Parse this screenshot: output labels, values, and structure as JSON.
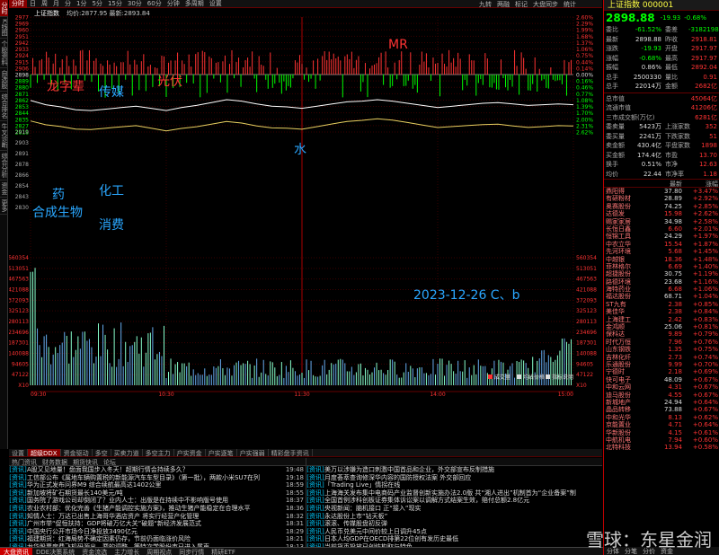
{
  "left_tabs": [
    "分时",
    "K线图",
    "个股资料",
    "自选股",
    "综合排名",
    "牛叉诊断",
    "综合分析",
    "资金",
    "更多"
  ],
  "toolbar": {
    "items": [
      "分时",
      "日",
      "周",
      "月",
      "分",
      "1分",
      "5分",
      "15分",
      "30分",
      "60分",
      "分钟",
      "多周期",
      "设置"
    ],
    "right": [
      "九转",
      "两融",
      "标记",
      "大盘同步",
      "统计"
    ]
  },
  "chart_info": {
    "name": "上证指数",
    "meta": "均价:2877.95 最新:2893.84"
  },
  "price_axis": {
    "left": [
      "2977",
      "2969",
      "2960",
      "2951",
      "2942",
      "2933",
      "2924",
      "2915",
      "2906",
      "2898",
      "2889",
      "2880",
      "2871",
      "2862",
      "2853",
      "2844",
      "2835",
      "2827",
      "2818"
    ],
    "right": [
      "2.60%",
      "2.29%",
      "1.99%",
      "1.68%",
      "1.37%",
      "1.06%",
      "0.75%",
      "0.44%",
      "0.14%",
      "0.00%",
      "0.16%",
      "0.46%",
      "0.77%",
      "1.08%",
      "1.39%",
      "1.70%",
      "2.00%",
      "2.31%",
      "2.62%"
    ]
  },
  "indicator_axis": [
    "2919",
    "2903",
    "2891",
    "2878",
    "2866",
    "2854",
    "2843",
    "2830"
  ],
  "volume_axis": [
    "560354",
    "513051",
    "467563",
    "421088",
    "372093",
    "325123",
    "280113",
    "234696",
    "187301",
    "140088",
    "94605",
    "47122",
    "X10"
  ],
  "time_labels": [
    "09:30",
    "10:30",
    "11:30",
    "14:00",
    "15:00"
  ],
  "volume_legend": [
    "成交量",
    "均线价格",
    "指标说明"
  ],
  "chart_data": {
    "type": "line",
    "title": "",
    "series": [
      {
        "values": [
          2898.88,
          2893,
          2890,
          2886,
          2885,
          2887,
          2889,
          2891,
          2888,
          2885,
          2889,
          2892,
          2896,
          2900,
          2898,
          2894,
          2891,
          2890,
          2888,
          2891,
          2894,
          2897,
          2898,
          2900,
          2898,
          2895,
          2892,
          2889,
          2891,
          2893,
          2895,
          2896,
          2894,
          2892,
          2893,
          2894,
          2893
        ]
      }
    ]
  },
  "annotations": {
    "a1": "龙字辈",
    "a2": "传媒",
    "a3": "光伏",
    "a4": "MR",
    "a5": "水",
    "a6": "药",
    "a7": "化工",
    "a8": "合成生物",
    "a9": "消费",
    "a10": "2023-12-26 C、b"
  },
  "bottom_tabs": [
    "设置",
    "超级DDX",
    "资金驱动",
    "多空",
    "买卖力道",
    "多空主力",
    "户实资金",
    "户实逐笔",
    "户实强弱",
    "精彩盘手资讯"
  ],
  "news_left_head": [
    "热门资讯",
    "财务数据",
    "期货快讯",
    "论坛"
  ],
  "news_right_head": [
    "",
    ""
  ],
  "news_left": [
    {
      "b": "资讯",
      "t": "A股又见地量！盘面我国步入冬天！超期行情会持续多久？",
      "tm": "19:48"
    },
    {
      "b": "资讯",
      "t": "工信部公布《属地车辆购置税的新能源汽车车型目录》（第一批），两款小米SU7在列",
      "tm": "19:18"
    },
    {
      "b": "资讯",
      "t": "华为正式发布问界M9 综合续航最高达1402公里",
      "tm": "18:59"
    },
    {
      "b": "资讯",
      "t": "新加坡将矿石期货最长140美元/吨",
      "tm": "18:55"
    },
    {
      "b": "资讯",
      "t": "国务院了游戏公司却倒闭了？业内人士：出版是在持续中不影响版号使用",
      "tm": "18:37"
    },
    {
      "b": "资讯",
      "t": "农业农村部：优化完善《生猪产能调控实施方案》，推动生猪产能稳定在合理水平",
      "tm": "18:36"
    },
    {
      "b": "资讯",
      "t": "知情人士：万达已出售上海哥华酒店资产 将实行经营产化管理",
      "tm": "18:32"
    },
    {
      "b": "资讯",
      "t": "广州市举“促恒扶持：GDP将破万亿大关”破题“新经济发展范式",
      "tm": "18:31"
    },
    {
      "b": "资讯",
      "t": "中国央行公开市场今日净投放3490亿元",
      "tm": "18:29"
    },
    {
      "b": "资讯",
      "t": "福建期货：红海局势不确定因素仍存，节前仍面临涨价风险",
      "tm": "18:21"
    },
    {
      "b": "资讯",
      "t": "龙华股票度费飞机码源出，要的调整，等特次学股份市已进入尾声",
      "tm": "18:13"
    },
    {
      "b": "资讯",
      "t": "产业链人士：预计华为nova 12系列出货量千万级",
      "tm": "18:13"
    }
  ],
  "news_right": [
    {
      "b": "资讯",
      "t": "美万以涉嫌为造口刺激中国首品和企业，外交部宣布反制措施",
      "tm": ""
    },
    {
      "b": "资讯",
      "t": "月度荟萃查询修深华内容的国防授权法案 外交部回应",
      "tm": ""
    },
    {
      "b": "资讯",
      "t": "「Trading Live」情拐在线",
      "tm": ""
    },
    {
      "b": "资讯",
      "t": "上海海关发布集中电商码产业监督创新实施办法2.0版 共“湘人进出”机制首为“企业备案”制",
      "tm": ""
    },
    {
      "b": "资讯",
      "t": "全国首例涉科创板证券集体诉讼案以调解方式结案生效，赔付总额2.8亿元",
      "tm": ""
    },
    {
      "b": "资讯",
      "t": "央视新闻：脑机接口 正“接入”现实",
      "tm": ""
    },
    {
      "b": "资讯",
      "t": "永达股份上市“钻天板”",
      "tm": ""
    },
    {
      "b": "资讯",
      "t": "滚滚、传媒股盘初反弹",
      "tm": ""
    },
    {
      "b": "资讯",
      "t": "人民币兑美元中间价较上日调升45点",
      "tm": ""
    },
    {
      "b": "资讯",
      "t": "日本人均GDP在OECD排第22位创有发历史最低",
      "tm": ""
    },
    {
      "b": "资讯",
      "t": "当前货币投放已创结构取与特色",
      "tm": ""
    },
    {
      "b": "资讯",
      "t": "知情人士：泸州老窖降价引发经销商不满，为平息怒火宣布价格回调",
      "tm": ""
    }
  ],
  "status": [
    "大盘资讯",
    "DDE决策系统",
    "资金流选",
    "主力增长",
    "周期视点",
    "同步行情",
    "精研ETF"
  ],
  "quote": {
    "header": "上证指数 000001",
    "price": "2898.88",
    "change": "-19.93",
    "pct": "-0.68%",
    "rows": [
      [
        "委比",
        "-61.52%",
        "委差",
        "-31821987"
      ],
      [
        "最新",
        "2898.88",
        "昨收",
        "2918.81"
      ],
      [
        "涨跌",
        "-19.93",
        "开盘",
        "2917.97"
      ],
      [
        "涨幅",
        "-0.68%",
        "最高",
        "2917.97"
      ],
      [
        "振幅",
        "0.86%",
        "最低",
        "2892.04"
      ],
      [
        "总手",
        "2500330",
        "量比",
        "0.91"
      ],
      [
        "总手",
        "22014万",
        "金额",
        "2682亿"
      ]
    ],
    "rows2": [
      [
        "总市值",
        "",
        "",
        "45064亿"
      ],
      [
        "流通市值",
        "",
        "",
        "41206亿"
      ],
      [
        "三市成交额(万亿)",
        "",
        "",
        "6281亿"
      ],
      [
        "委卖量",
        "5423万",
        "上涨家数",
        "352"
      ],
      [
        "委买量",
        "2241万",
        "下跌家数",
        "51"
      ],
      [
        "卖金额",
        "430.4亿",
        "平盘家数",
        "1898"
      ],
      [
        "买金额",
        "174.4亿",
        "市盈",
        "13.70"
      ],
      [
        "换手",
        "0.51%",
        "市净",
        "12.63"
      ],
      [
        "均价",
        "22.44",
        "市净率",
        "1.18"
      ]
    ],
    "stock_head": [
      "",
      "最新",
      "涨幅"
    ],
    "stocks": [
      [
        "鼎阳得",
        "37.80",
        "+3.47%"
      ],
      [
        "有研粉材",
        "28.89",
        "+2.92%"
      ],
      [
        "奥赛股份",
        "74.25",
        "+2.85%"
      ],
      [
        "达德发",
        "15.98",
        "+2.62%"
      ],
      [
        "赐家家居",
        "34.98",
        "+2.58%"
      ],
      [
        "长恒日鑫",
        "6.60",
        "+2.01%"
      ],
      [
        "恒锦工具",
        "24.29",
        "+1.97%"
      ],
      [
        "中农立华",
        "15.54",
        "+1.87%"
      ],
      [
        "先河环境",
        "5.68",
        "+1.45%"
      ],
      [
        "中越银",
        "18.36",
        "+1.48%"
      ],
      [
        "菲林格尔",
        "6.69",
        "+1.40%"
      ],
      [
        "超捷股份",
        "30.75",
        "+1.19%"
      ],
      [
        "路德环境",
        "23.68",
        "+1.16%"
      ],
      [
        "海特药业",
        "6.68",
        "+1.06%"
      ],
      [
        "福达股份",
        "68.71",
        "+1.04%"
      ],
      [
        "ST九有",
        "2.38",
        "+0.85%"
      ],
      [
        "美佳华",
        "2.38",
        "+0.84%"
      ],
      [
        "上海建工",
        "2.42",
        "+0.83%"
      ],
      [
        "金鸿顺",
        "25.06",
        "+0.81%"
      ],
      [
        "保科达",
        "9.89",
        "+0.79%"
      ],
      [
        "时代万恒",
        "7.96",
        "+0.76%"
      ],
      [
        "山东钢铁",
        "1.35",
        "+0.75%"
      ],
      [
        "吉林化纤",
        "2.73",
        "+0.74%"
      ],
      [
        "乐通股份",
        "9.99",
        "+0.70%"
      ],
      [
        "宁德时",
        "2.18",
        "+0.69%"
      ],
      [
        "快可电子",
        "48.09",
        "+0.67%"
      ],
      [
        "中和云网",
        "4.31",
        "+0.67%"
      ],
      [
        "迪马股份",
        "4.55",
        "+0.67%"
      ],
      [
        "新城地产",
        "24.94",
        "+0.64%"
      ],
      [
        "晶品转移",
        "73.88",
        "+0.67%"
      ],
      [
        "中和光华",
        "8.13",
        "+0.62%"
      ],
      [
        "京能置业",
        "4.71",
        "+0.64%"
      ],
      [
        "华新股份",
        "4.15",
        "+0.61%"
      ],
      [
        "中航机电",
        "7.94",
        "+0.60%"
      ],
      [
        "北特科技",
        "13.94",
        "+0.58%"
      ]
    ],
    "bottom": [
      "分体",
      "分笔",
      "分价",
      "资金"
    ]
  },
  "watermark": "雪球：东星金润",
  "colors": {
    "bg": "#000000",
    "up": "#ff3333",
    "down": "#00ff00",
    "line": "#ffffff",
    "avg": "#ffff00",
    "grid": "#3a0000",
    "annot_red": "#ff3333",
    "annot_blue": "#2aa7ff"
  }
}
